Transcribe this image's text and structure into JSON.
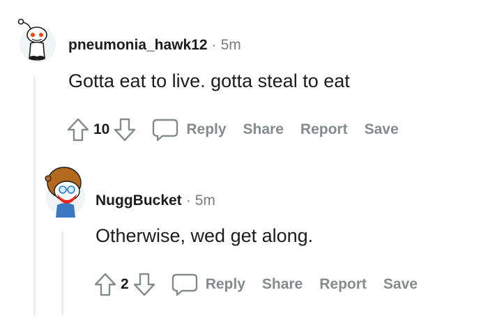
{
  "comments": [
    {
      "username": "pneumonia_hawk12",
      "separator": "·",
      "time": "5m",
      "text": "Gotta eat to live. gotta steal to eat",
      "score": "10",
      "actions": {
        "reply": "Reply",
        "share": "Share",
        "report": "Report",
        "save": "Save"
      }
    },
    {
      "username": "NuggBucket",
      "separator": "·",
      "time": "5m",
      "text": "Otherwise, wed get along.",
      "score": "2",
      "actions": {
        "reply": "Reply",
        "share": "Share",
        "report": "Report",
        "save": "Save"
      }
    }
  ],
  "icons": {
    "upvote": "upvote-arrow-icon",
    "downvote": "downvote-arrow-icon",
    "reply": "speech-bubble-icon",
    "avatar1": "reddit-snoo-avatar",
    "avatar2": "reddit-redhead-avatar"
  },
  "colors": {
    "muted": "#878a8c",
    "text": "#1c1c1c",
    "thread": "#e9ebed",
    "snoo_eye": "#ff4500"
  }
}
